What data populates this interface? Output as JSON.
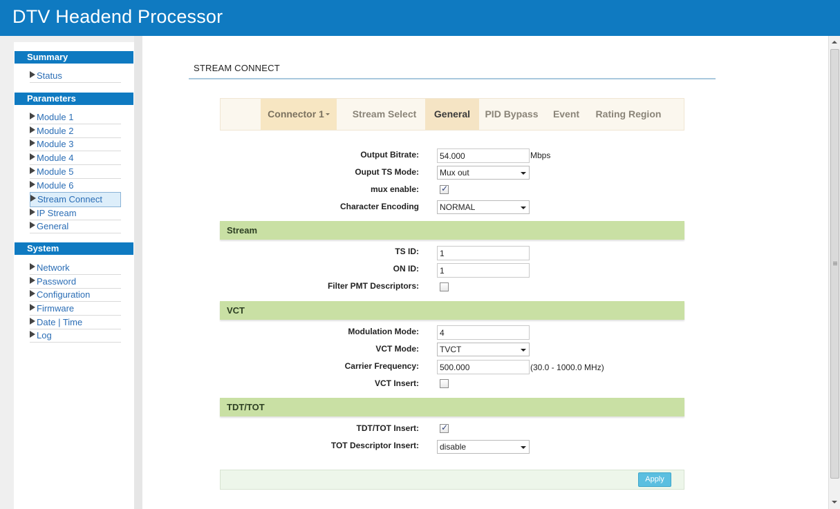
{
  "app": {
    "title": "DTV Headend Processor"
  },
  "sidebar": {
    "sections": [
      {
        "title": "Summary",
        "items": [
          "Status"
        ]
      },
      {
        "title": "Parameters",
        "items": [
          "Module 1",
          "Module 2",
          "Module 3",
          "Module 4",
          "Module 5",
          "Module 6",
          "Stream Connect",
          "IP Stream",
          "General"
        ]
      },
      {
        "title": "System",
        "items": [
          "Network",
          "Password",
          "Configuration",
          "Firmware",
          "Date | Time",
          "Log"
        ]
      }
    ],
    "active_item": "Stream Connect"
  },
  "page": {
    "title": "STREAM CONNECT"
  },
  "tabs": [
    {
      "label": "Connector 1"
    },
    {
      "label": "Stream Select"
    },
    {
      "label": "General"
    },
    {
      "label": "PID Bypass"
    },
    {
      "label": "Event"
    },
    {
      "label": "Rating Region"
    }
  ],
  "active_tab": "General",
  "general": {
    "output_bitrate": {
      "label": "Output Bitrate:",
      "value": "54.000",
      "unit": "Mbps"
    },
    "output_ts_mode": {
      "label": "Ouput TS Mode:",
      "value": "Mux out"
    },
    "mux_enable": {
      "label": "mux enable:",
      "checked": true
    },
    "character_encoding": {
      "label": "Character Encoding",
      "value": "NORMAL"
    }
  },
  "stream": {
    "title": "Stream",
    "ts_id": {
      "label": "TS ID:",
      "value": "1"
    },
    "on_id": {
      "label": "ON ID:",
      "value": "1"
    },
    "filter_pmt": {
      "label": "Filter PMT Descriptors:",
      "checked": false
    }
  },
  "vct": {
    "title": "VCT",
    "modulation_mode": {
      "label": "Modulation Mode:",
      "value": "4"
    },
    "vct_mode": {
      "label": "VCT Mode:",
      "value": "TVCT"
    },
    "carrier_frequency": {
      "label": "Carrier Frequency:",
      "value": "500.000",
      "unit": "(30.0 - 1000.0 MHz)"
    },
    "vct_insert": {
      "label": "VCT Insert:",
      "checked": false
    }
  },
  "tdt_tot": {
    "title": "TDT/TOT",
    "tdt_tot_insert": {
      "label": "TDT/TOT Insert:",
      "checked": true
    },
    "tot_descriptor_insert": {
      "label": "TOT Descriptor Insert:",
      "value": "disable"
    }
  },
  "footer": {
    "apply_label": "Apply"
  },
  "colors": {
    "header": "#0f7ac1",
    "band": "#c9e0a4",
    "tab_active": "#f5e4c4",
    "apply": "#5bbfe0"
  },
  "icons": {
    "nav_arrow": "triangle-right-icon",
    "checkbox_mark": "check-icon"
  }
}
